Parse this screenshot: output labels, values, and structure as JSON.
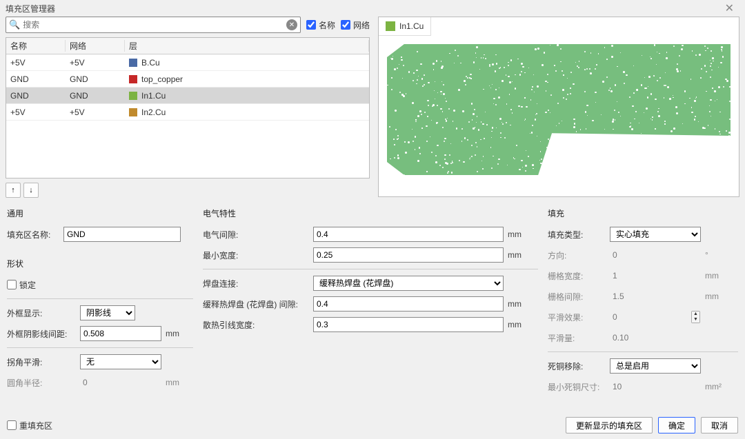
{
  "window": {
    "title": "填充区管理器"
  },
  "search": {
    "placeholder": "搜索",
    "chk_name": "名称",
    "chk_net": "网络"
  },
  "table": {
    "headers": {
      "name": "名称",
      "net": "网络",
      "layer": "层"
    },
    "rows": [
      {
        "name": "+5V",
        "net": "+5V",
        "layer": "B.Cu",
        "color": "#4a6aa5",
        "selected": false
      },
      {
        "name": "GND",
        "net": "GND",
        "layer": "top_copper",
        "color": "#c62828",
        "selected": false
      },
      {
        "name": "GND",
        "net": "GND",
        "layer": "In1.Cu",
        "color": "#7cb342",
        "selected": true
      },
      {
        "name": "+5V",
        "net": "+5V",
        "layer": "In2.Cu",
        "color": "#c08a2d",
        "selected": false
      }
    ]
  },
  "preview": {
    "tab_label": "In1.Cu",
    "tab_color": "#7cb342"
  },
  "general": {
    "title": "通用",
    "zone_name_label": "填充区名称:",
    "zone_name": "GND"
  },
  "shape": {
    "title": "形状",
    "lock_label": "锁定",
    "outline_display_label": "外框显示:",
    "outline_display": "阴影线",
    "hatch_pitch_label": "外框阴影线间距:",
    "hatch_pitch": "0.508",
    "corner_smooth_label": "拐角平滑:",
    "corner_smooth": "无",
    "corner_radius_label": "圆角半径:",
    "corner_radius": "0"
  },
  "electrical": {
    "title": "电气特性",
    "clearance_label": "电气间隙:",
    "clearance": "0.4",
    "min_width_label": "最小宽度:",
    "min_width": "0.25",
    "pad_connection_label": "焊盘连接:",
    "pad_connection": "缓释热焊盘 (花焊盘)",
    "thermal_gap_label": "缓释热焊盘 (花焊盘) 间隙:",
    "thermal_gap": "0.4",
    "spoke_width_label": "散热引线宽度:",
    "spoke_width": "0.3"
  },
  "fill": {
    "title": "填充",
    "fill_type_label": "填充类型:",
    "fill_type": "实心填充",
    "orientation_label": "方向:",
    "orientation": "0",
    "grid_width_label": "栅格宽度:",
    "grid_width": "1",
    "grid_gap_label": "栅格间隙:",
    "grid_gap": "1.5",
    "smooth_effect_label": "平滑效果:",
    "smooth_effect": "0",
    "smooth_amount_label": "平滑量:",
    "smooth_amount": "0.10",
    "remove_islands_label": "死铜移除:",
    "remove_islands": "总是启用",
    "min_island_label": "最小死铜尺寸:",
    "min_island": "10"
  },
  "footer": {
    "refill_label": "重填充区",
    "update_label": "更新显示的填充区",
    "ok_label": "确定",
    "cancel_label": "取消"
  },
  "units": {
    "mm": "mm",
    "deg": "°",
    "mm2": "mm²"
  }
}
